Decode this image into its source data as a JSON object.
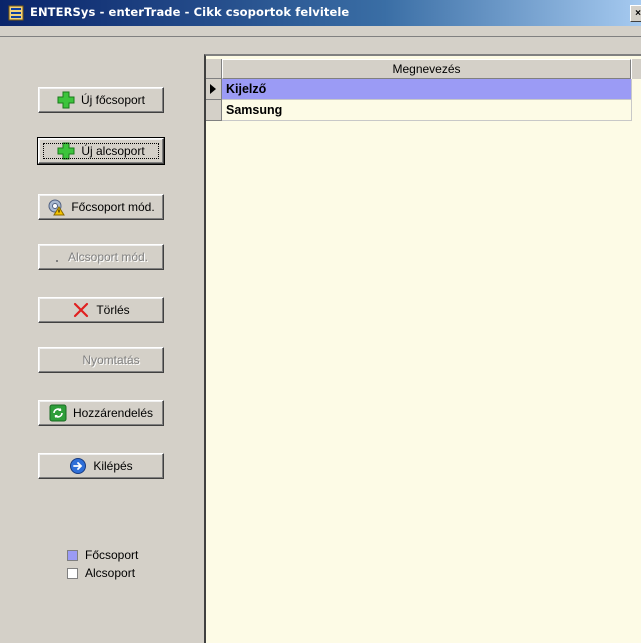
{
  "window": {
    "title": "ENTERSys - enterTrade - Cikk csoportok felvitele",
    "icon": "app-window-icon"
  },
  "buttons": {
    "new_main_group": "Új főcsoport",
    "new_sub_group": "Új alcsoport",
    "edit_main_group": "Főcsoport mód.",
    "edit_sub_group": "Alcsoport mód.",
    "delete": "Törlés",
    "print": "Nyomtatás",
    "assign": "Hozzárendelés",
    "exit": "Kilépés"
  },
  "legend": {
    "main_group": "Főcsoport",
    "sub_group": "Alcsoport",
    "main_group_color": "#9b9bf5",
    "sub_group_color": "#ffffff"
  },
  "grid": {
    "column_header": "Megnevezés",
    "rows": [
      {
        "name": "Kijelző",
        "type": "main_group",
        "selected": true
      },
      {
        "name": "Samsung",
        "type": "sub_group",
        "selected": false
      }
    ]
  },
  "colors": {
    "selected_row": "#9b9bf5",
    "grid_background": "#fdfbe6",
    "window_face": "#d4d0c8"
  }
}
